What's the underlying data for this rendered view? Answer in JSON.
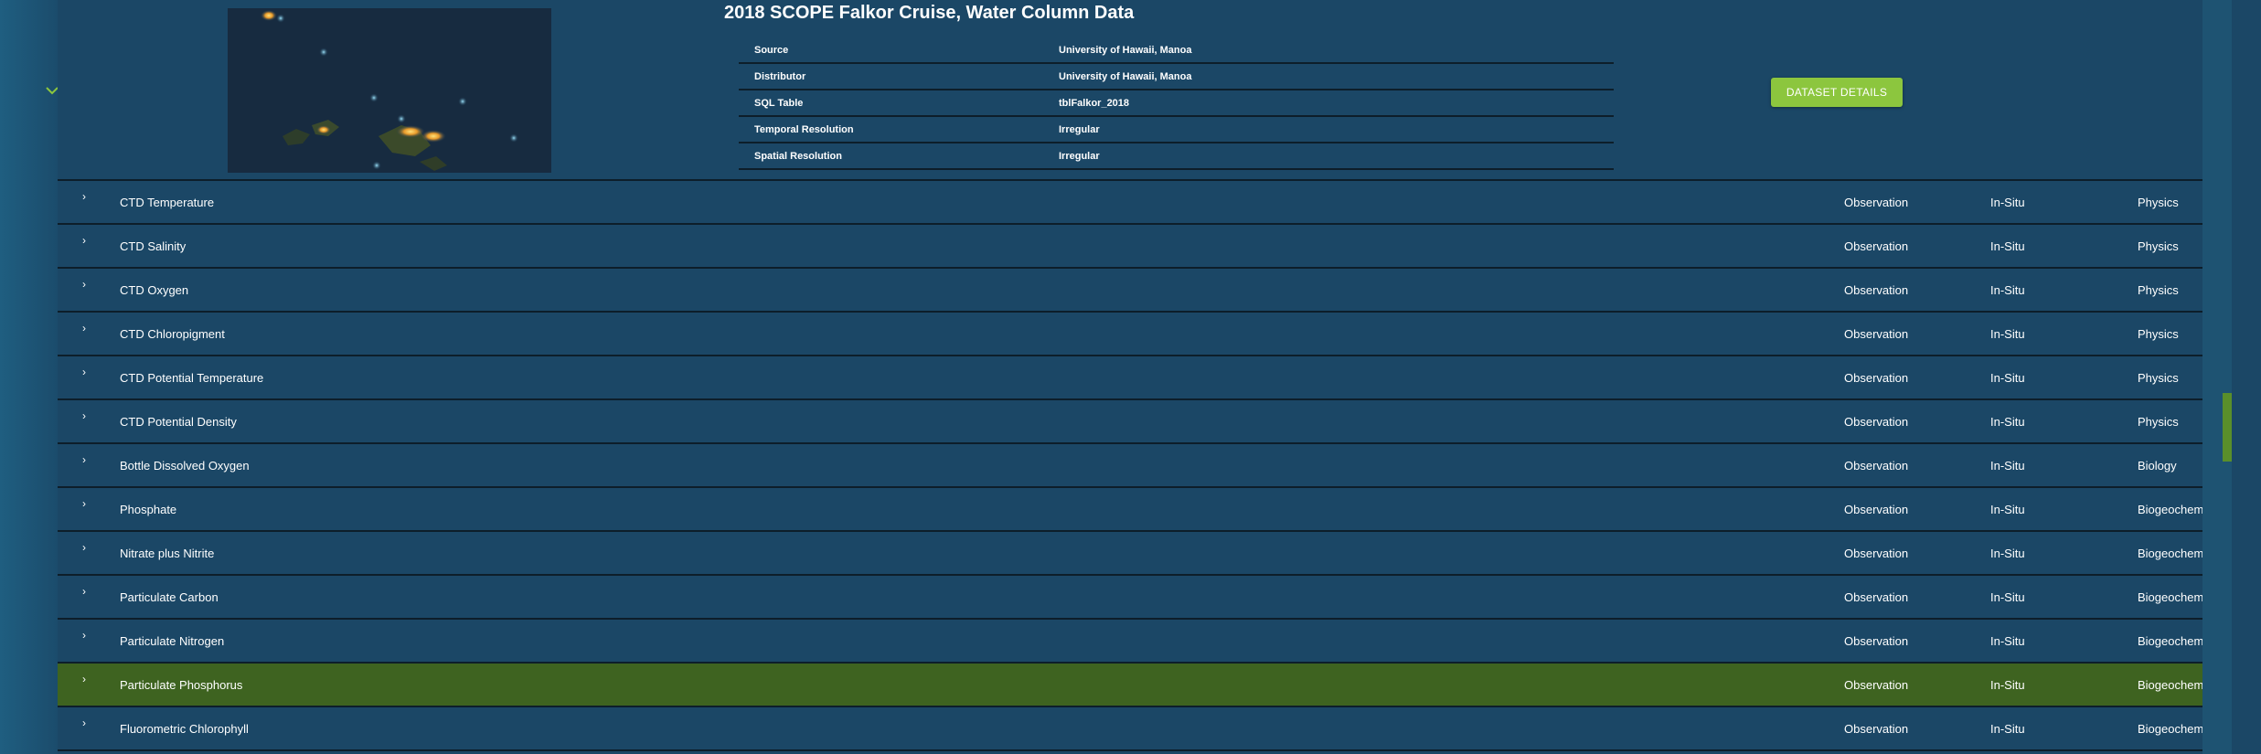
{
  "dataset": {
    "title": "2018 SCOPE Falkor Cruise, Water Column Data",
    "map_icon": "cruise-track-map",
    "details_button": "DATASET DETAILS",
    "metadata": [
      {
        "key": "Source",
        "value": "University of Hawaii, Manoa"
      },
      {
        "key": "Distributor",
        "value": "University of Hawaii, Manoa"
      },
      {
        "key": "SQL Table",
        "value": "tblFalkor_2018"
      },
      {
        "key": "Temporal Resolution",
        "value": "Irregular"
      },
      {
        "key": "Spatial Resolution",
        "value": "Irregular"
      }
    ]
  },
  "toggle_icon": "chevron-down-icon",
  "expand_icon": "chevron-right-icon",
  "variables": [
    {
      "name": "CTD Temperature",
      "make": "Observation",
      "sensor": "In-Situ",
      "discipline": "Physics"
    },
    {
      "name": "CTD Salinity",
      "make": "Observation",
      "sensor": "In-Situ",
      "discipline": "Physics"
    },
    {
      "name": "CTD Oxygen",
      "make": "Observation",
      "sensor": "In-Situ",
      "discipline": "Physics"
    },
    {
      "name": "CTD Chloropigment",
      "make": "Observation",
      "sensor": "In-Situ",
      "discipline": "Physics"
    },
    {
      "name": "CTD Potential Temperature",
      "make": "Observation",
      "sensor": "In-Situ",
      "discipline": "Physics"
    },
    {
      "name": "CTD Potential Density",
      "make": "Observation",
      "sensor": "In-Situ",
      "discipline": "Physics"
    },
    {
      "name": "Bottle Dissolved Oxygen",
      "make": "Observation",
      "sensor": "In-Situ",
      "discipline": "Biology"
    },
    {
      "name": "Phosphate",
      "make": "Observation",
      "sensor": "In-Situ",
      "discipline": "Biogeochemistry"
    },
    {
      "name": "Nitrate plus Nitrite",
      "make": "Observation",
      "sensor": "In-Situ",
      "discipline": "Biogeochemistry"
    },
    {
      "name": "Particulate Carbon",
      "make": "Observation",
      "sensor": "In-Situ",
      "discipline": "Biogeochemistry"
    },
    {
      "name": "Particulate Nitrogen",
      "make": "Observation",
      "sensor": "In-Situ",
      "discipline": "Biogeochemistry"
    },
    {
      "name": "Particulate Phosphorus",
      "make": "Observation",
      "sensor": "In-Situ",
      "discipline": "Biogeochemistry",
      "selected": true
    },
    {
      "name": "Fluorometric Chlorophyll",
      "make": "Observation",
      "sensor": "In-Situ",
      "discipline": "Biogeochemistry"
    }
  ],
  "colors": {
    "background": "#1b4766",
    "selected_row": "#3e6320",
    "accent": "#8cc63e",
    "row_divider": "#0d1e2a"
  }
}
